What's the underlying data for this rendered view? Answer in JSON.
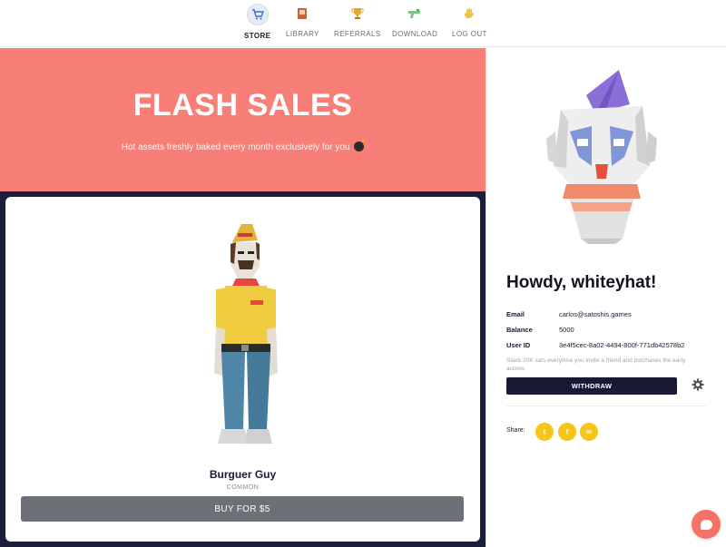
{
  "nav": {
    "items": [
      {
        "label": "STORE",
        "icon": "cart-icon"
      },
      {
        "label": "LIBRARY",
        "icon": "book-icon"
      },
      {
        "label": "REFERRALS",
        "icon": "trophy-icon"
      },
      {
        "label": "DOWNLOAD",
        "icon": "gun-icon"
      },
      {
        "label": "LOG OUT",
        "icon": "wave-hand-icon"
      }
    ],
    "active": "STORE"
  },
  "hero": {
    "title": "FLASH SALES",
    "subtitle": "Hot assets freshly baked every month exclusively for you",
    "emoji_icon": "bomb-icon",
    "bg_color": "#f77f78"
  },
  "product": {
    "name": "Burguer Guy",
    "rarity": "COMMON",
    "buy_label": "BUY FOR $5",
    "image_icon": "burger-guy-character-icon"
  },
  "profile": {
    "greeting": "Howdy, whiteyhat!",
    "avatar_icon": "clown-mask-avatar-icon",
    "fields": [
      {
        "label": "Email",
        "value": "carlos@satoshis.games"
      },
      {
        "label": "Balance",
        "value": "5000"
      },
      {
        "label": "User ID",
        "value": "3e4f5cec-8a02-4494-800f-771db42578b2"
      }
    ],
    "hint": "Stack 20K sats everytime you invite a friend and purchases the early access",
    "withdraw_label": "WITHDRAW",
    "share_label": "Share:",
    "social": [
      {
        "name": "twitter",
        "glyph": "t"
      },
      {
        "name": "facebook",
        "glyph": "f"
      },
      {
        "name": "message",
        "glyph": "✉"
      }
    ]
  },
  "colors": {
    "accent": "#f77f78",
    "dark": "#1c1f3a",
    "social": "#f5c518",
    "chat": "#f87166"
  }
}
